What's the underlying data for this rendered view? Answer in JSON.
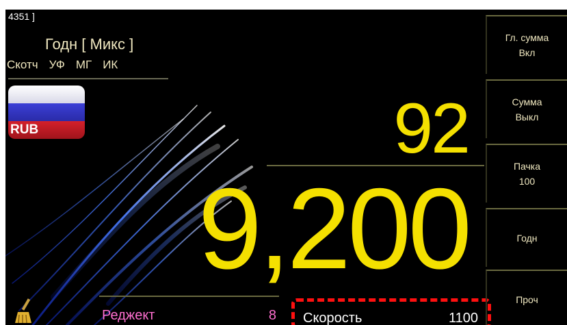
{
  "header": {
    "counter_id": "4351 ]",
    "mode_title": "Годн [ Микс ]",
    "sensors": [
      "Скотч",
      "УФ",
      "МГ",
      "ИК"
    ]
  },
  "currency": {
    "code": "RUB",
    "flag_icon": "russia-flag-icon"
  },
  "display": {
    "count": "92",
    "amount": "9,200"
  },
  "status": {
    "reject_label": "Реджект",
    "reject_value": "8",
    "speed_label": "Скорость",
    "speed_value": "1100"
  },
  "side_menu": [
    {
      "line1": "Гл. сумма",
      "line2": "Вкл"
    },
    {
      "line1": "Сумма",
      "line2": "Выкл"
    },
    {
      "line1": "Пачка",
      "line2": "100"
    },
    {
      "line1": "Годн",
      "line2": ""
    },
    {
      "line1": "Проч",
      "line2": ""
    }
  ],
  "colors": {
    "value_yellow": "#f4e000",
    "reject_pink": "#ff6fd0",
    "highlight_red": "#ff1010",
    "label_cream": "#f0e8c0"
  },
  "icons": {
    "broom": "broom-icon"
  }
}
